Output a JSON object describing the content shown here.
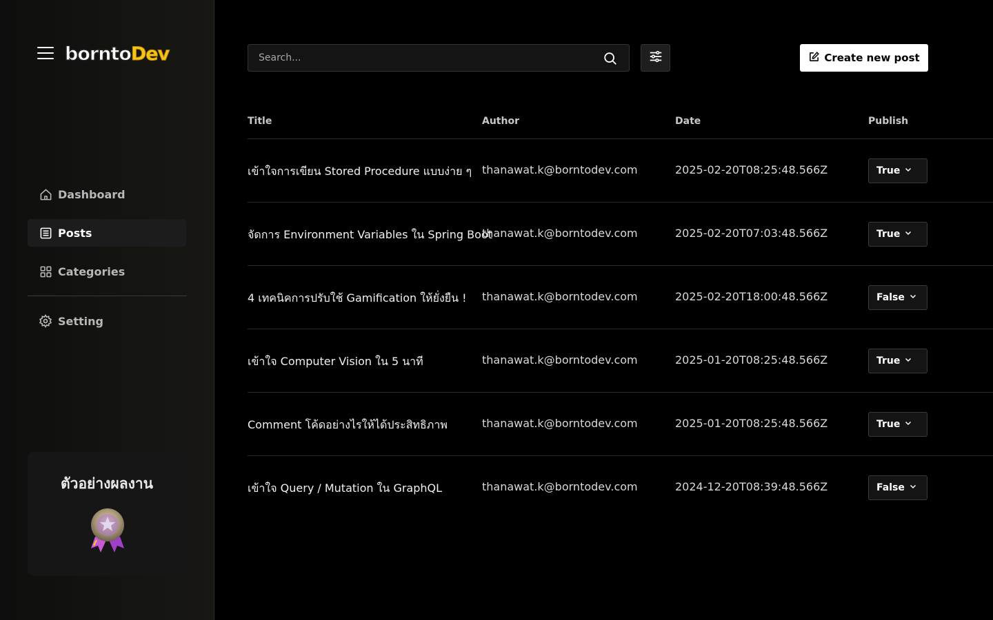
{
  "sidebar": {
    "logo_part1": "bornto",
    "logo_part2": "Dev",
    "items": [
      {
        "label": "Dashboard",
        "icon": "home-icon"
      },
      {
        "label": "Posts",
        "icon": "list-icon"
      },
      {
        "label": "Categories",
        "icon": "grid-icon"
      }
    ],
    "setting": {
      "label": "Setting",
      "icon": "gear-icon"
    },
    "promo_title": "ตัวอย่างผลงาน"
  },
  "toolbar": {
    "search_placeholder": "Search...",
    "create_label": "Create new post"
  },
  "table": {
    "columns": [
      "Title",
      "Author",
      "Date",
      "Publish"
    ],
    "rows": [
      {
        "title": "เข้าใจการเขียน Stored Procedure แบบง่าย ๆ",
        "author": "thanawat.k@borntodev.com",
        "date": "2025-02-20T08:25:48.566Z",
        "publish": "True"
      },
      {
        "title": "จัดการ Environment Variables ใน Spring Boot",
        "author": "thanawat.k@borntodev.com",
        "date": "2025-02-20T07:03:48.566Z",
        "publish": "True"
      },
      {
        "title": "4 เทคนิคการปรับใช้ Gamification ให้ยั่งยืน !",
        "author": "thanawat.k@borntodev.com",
        "date": "2025-02-20T18:00:48.566Z",
        "publish": "False"
      },
      {
        "title": "เข้าใจ Computer Vision ใน 5 นาที",
        "author": "thanawat.k@borntodev.com",
        "date": "2025-01-20T08:25:48.566Z",
        "publish": "True"
      },
      {
        "title": "Comment โค้ดอย่างไรให้ได้ประสิทธิภาพ",
        "author": "thanawat.k@borntodev.com",
        "date": "2025-01-20T08:25:48.566Z",
        "publish": "True"
      },
      {
        "title": "เข้าใจ Query / Mutation ใน GraphQL",
        "author": "thanawat.k@borntodev.com",
        "date": "2024-12-20T08:39:48.566Z",
        "publish": "False"
      }
    ]
  },
  "colors": {
    "background": "#000000",
    "accent": "#f5c518",
    "button": "#ffffff"
  }
}
